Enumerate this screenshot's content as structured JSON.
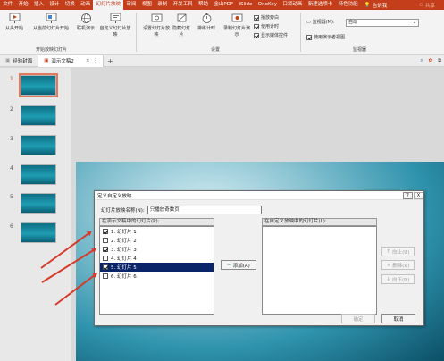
{
  "ribbon_tabs": [
    "文件",
    "开始",
    "插入",
    "设计",
    "切换",
    "动画",
    "幻灯片放映",
    "审阅",
    "视图",
    "录制",
    "开发工具",
    "帮助",
    "金山PDF",
    "iSlide",
    "OneKey",
    "口袋动画",
    "新建选项卡",
    "特色功能"
  ],
  "active_tab_index": 6,
  "tell_me": "告诉我",
  "user_label": "共享",
  "ribbon": {
    "from_start": "从头开始",
    "from_current": "从当前幻灯片开始",
    "online_present": "联机演示",
    "custom_show": "自定义幻灯片放映",
    "group_start": "开始放映幻灯片",
    "setup_show": "设置幻灯片放映",
    "hide_slide": "隐藏幻灯片",
    "rehearse": "排练计时",
    "record": "录制幻灯片演示",
    "play_narrations": "播放旁白",
    "use_timings": "使用计时",
    "show_media_controls": "显示媒体控件",
    "group_setup": "设置",
    "monitor_label": "监视器(M):",
    "monitor_value": "自动",
    "presenter_view": "使用演示者视图",
    "group_monitors": "监视器"
  },
  "doc_tabs": [
    {
      "label": "经验封面"
    },
    {
      "label": "演示文稿2"
    }
  ],
  "slide_numbers": [
    "1",
    "2",
    "3",
    "4",
    "5",
    "6"
  ],
  "dialog": {
    "title": "定义自定义放映",
    "help": "?",
    "close": "X",
    "name_label": "幻灯片放映名称(N):",
    "name_value": "只播放奇数页",
    "left_header": "在演示文稿中的幻灯片(P):",
    "right_header": "在自定义放映中的幻灯片(L):",
    "slides": [
      {
        "label": "1. 幻灯片 1",
        "checked": true,
        "selected": false
      },
      {
        "label": "2. 幻灯片 2",
        "checked": false,
        "selected": false
      },
      {
        "label": "3. 幻灯片 3",
        "checked": true,
        "selected": false
      },
      {
        "label": "4. 幻灯片 4",
        "checked": false,
        "selected": false
      },
      {
        "label": "5. 幻灯片 5",
        "checked": true,
        "selected": true
      },
      {
        "label": "6. 幻灯片 6",
        "checked": false,
        "selected": false
      }
    ],
    "add_button": "添加(A)",
    "up_button": "向上(U)",
    "delete_button": "删除(R)",
    "down_button": "向下(D)",
    "ok_button": "确定",
    "cancel_button": "取消"
  }
}
